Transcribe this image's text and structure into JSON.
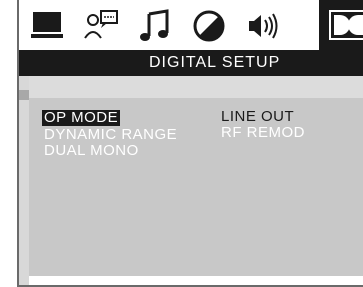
{
  "icon_bar": {
    "icons": [
      {
        "name": "monitor-icon"
      },
      {
        "name": "language-icon"
      },
      {
        "name": "music-note-icon"
      },
      {
        "name": "picture-contrast-icon"
      },
      {
        "name": "speaker-icon"
      },
      {
        "name": "dolby-digital-icon",
        "selected": true
      }
    ]
  },
  "title_bar": {
    "title": "DIGITAL SETUP"
  },
  "menu": {
    "items": [
      {
        "label": "OP MODE",
        "selected": true
      },
      {
        "label": "DYNAMIC RANGE",
        "selected": false
      },
      {
        "label": "DUAL  MONO",
        "selected": false
      }
    ],
    "options": [
      {
        "label": "LINE OUT",
        "highlighted": true
      },
      {
        "label": "RF REMOD",
        "highlighted": false
      }
    ]
  },
  "colors": {
    "bar_black": "#1a1a1a",
    "panel_gray": "#c8c8c8",
    "text_white": "#ffffff"
  }
}
